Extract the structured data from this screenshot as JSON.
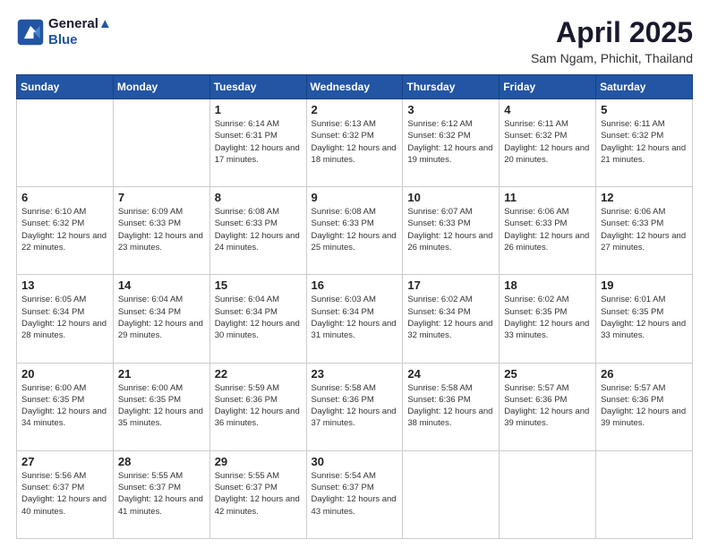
{
  "header": {
    "logo_line1": "General",
    "logo_line2": "Blue",
    "month_title": "April 2025",
    "location": "Sam Ngam, Phichit, Thailand"
  },
  "weekdays": [
    "Sunday",
    "Monday",
    "Tuesday",
    "Wednesday",
    "Thursday",
    "Friday",
    "Saturday"
  ],
  "weeks": [
    [
      {
        "day": "",
        "info": ""
      },
      {
        "day": "",
        "info": ""
      },
      {
        "day": "1",
        "info": "Sunrise: 6:14 AM\nSunset: 6:31 PM\nDaylight: 12 hours and 17 minutes."
      },
      {
        "day": "2",
        "info": "Sunrise: 6:13 AM\nSunset: 6:32 PM\nDaylight: 12 hours and 18 minutes."
      },
      {
        "day": "3",
        "info": "Sunrise: 6:12 AM\nSunset: 6:32 PM\nDaylight: 12 hours and 19 minutes."
      },
      {
        "day": "4",
        "info": "Sunrise: 6:11 AM\nSunset: 6:32 PM\nDaylight: 12 hours and 20 minutes."
      },
      {
        "day": "5",
        "info": "Sunrise: 6:11 AM\nSunset: 6:32 PM\nDaylight: 12 hours and 21 minutes."
      }
    ],
    [
      {
        "day": "6",
        "info": "Sunrise: 6:10 AM\nSunset: 6:32 PM\nDaylight: 12 hours and 22 minutes."
      },
      {
        "day": "7",
        "info": "Sunrise: 6:09 AM\nSunset: 6:33 PM\nDaylight: 12 hours and 23 minutes."
      },
      {
        "day": "8",
        "info": "Sunrise: 6:08 AM\nSunset: 6:33 PM\nDaylight: 12 hours and 24 minutes."
      },
      {
        "day": "9",
        "info": "Sunrise: 6:08 AM\nSunset: 6:33 PM\nDaylight: 12 hours and 25 minutes."
      },
      {
        "day": "10",
        "info": "Sunrise: 6:07 AM\nSunset: 6:33 PM\nDaylight: 12 hours and 26 minutes."
      },
      {
        "day": "11",
        "info": "Sunrise: 6:06 AM\nSunset: 6:33 PM\nDaylight: 12 hours and 26 minutes."
      },
      {
        "day": "12",
        "info": "Sunrise: 6:06 AM\nSunset: 6:33 PM\nDaylight: 12 hours and 27 minutes."
      }
    ],
    [
      {
        "day": "13",
        "info": "Sunrise: 6:05 AM\nSunset: 6:34 PM\nDaylight: 12 hours and 28 minutes."
      },
      {
        "day": "14",
        "info": "Sunrise: 6:04 AM\nSunset: 6:34 PM\nDaylight: 12 hours and 29 minutes."
      },
      {
        "day": "15",
        "info": "Sunrise: 6:04 AM\nSunset: 6:34 PM\nDaylight: 12 hours and 30 minutes."
      },
      {
        "day": "16",
        "info": "Sunrise: 6:03 AM\nSunset: 6:34 PM\nDaylight: 12 hours and 31 minutes."
      },
      {
        "day": "17",
        "info": "Sunrise: 6:02 AM\nSunset: 6:34 PM\nDaylight: 12 hours and 32 minutes."
      },
      {
        "day": "18",
        "info": "Sunrise: 6:02 AM\nSunset: 6:35 PM\nDaylight: 12 hours and 33 minutes."
      },
      {
        "day": "19",
        "info": "Sunrise: 6:01 AM\nSunset: 6:35 PM\nDaylight: 12 hours and 33 minutes."
      }
    ],
    [
      {
        "day": "20",
        "info": "Sunrise: 6:00 AM\nSunset: 6:35 PM\nDaylight: 12 hours and 34 minutes."
      },
      {
        "day": "21",
        "info": "Sunrise: 6:00 AM\nSunset: 6:35 PM\nDaylight: 12 hours and 35 minutes."
      },
      {
        "day": "22",
        "info": "Sunrise: 5:59 AM\nSunset: 6:36 PM\nDaylight: 12 hours and 36 minutes."
      },
      {
        "day": "23",
        "info": "Sunrise: 5:58 AM\nSunset: 6:36 PM\nDaylight: 12 hours and 37 minutes."
      },
      {
        "day": "24",
        "info": "Sunrise: 5:58 AM\nSunset: 6:36 PM\nDaylight: 12 hours and 38 minutes."
      },
      {
        "day": "25",
        "info": "Sunrise: 5:57 AM\nSunset: 6:36 PM\nDaylight: 12 hours and 39 minutes."
      },
      {
        "day": "26",
        "info": "Sunrise: 5:57 AM\nSunset: 6:36 PM\nDaylight: 12 hours and 39 minutes."
      }
    ],
    [
      {
        "day": "27",
        "info": "Sunrise: 5:56 AM\nSunset: 6:37 PM\nDaylight: 12 hours and 40 minutes."
      },
      {
        "day": "28",
        "info": "Sunrise: 5:55 AM\nSunset: 6:37 PM\nDaylight: 12 hours and 41 minutes."
      },
      {
        "day": "29",
        "info": "Sunrise: 5:55 AM\nSunset: 6:37 PM\nDaylight: 12 hours and 42 minutes."
      },
      {
        "day": "30",
        "info": "Sunrise: 5:54 AM\nSunset: 6:37 PM\nDaylight: 12 hours and 43 minutes."
      },
      {
        "day": "",
        "info": ""
      },
      {
        "day": "",
        "info": ""
      },
      {
        "day": "",
        "info": ""
      }
    ]
  ]
}
